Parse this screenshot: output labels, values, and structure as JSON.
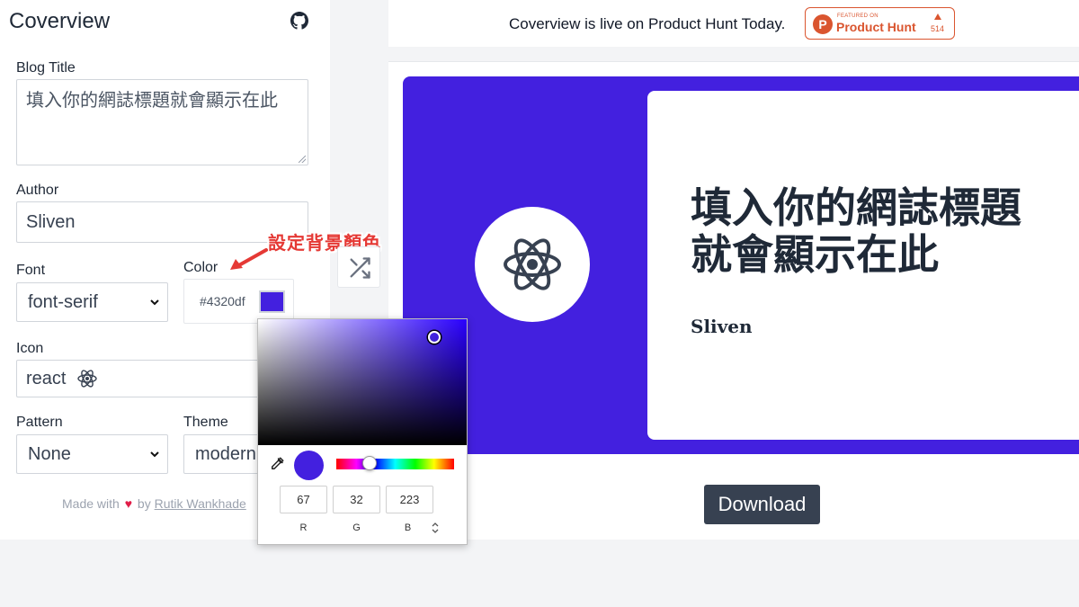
{
  "app": {
    "title": "Coverview"
  },
  "form": {
    "blog_title_label": "Blog Title",
    "blog_title_value": "填入你的網誌標題就會顯示在此",
    "author_label": "Author",
    "author_value": "Sliven",
    "font_label": "Font",
    "font_value": "font-serif",
    "color_label": "Color",
    "color_value": "#4320df",
    "icon_label": "Icon",
    "icon_value": "react",
    "pattern_label": "Pattern",
    "pattern_value": "None",
    "theme_label": "Theme",
    "theme_value": "modern"
  },
  "annotation": {
    "text": "設定背景顏色"
  },
  "footer": {
    "made_with": "Made with",
    "by": "by",
    "author_link": "Rutik Wankhade"
  },
  "banner": {
    "text": "Coverview is live on Product Hunt Today.",
    "badge_small": "FEATURED ON",
    "badge_name": "Product Hunt",
    "badge_count": "514"
  },
  "preview": {
    "title": "填入你的網誌標題就會顯示在此",
    "author": "Sliven",
    "background_color": "#4320df"
  },
  "download_label": "Download",
  "color_picker": {
    "r": "67",
    "g": "32",
    "b": "223",
    "r_label": "R",
    "g_label": "G",
    "b_label": "B",
    "mode_toggle_glyph": "⌃⌄"
  },
  "colors": {
    "accent": "#4320df",
    "product_hunt": "#da552f",
    "button_dark": "#374151"
  }
}
